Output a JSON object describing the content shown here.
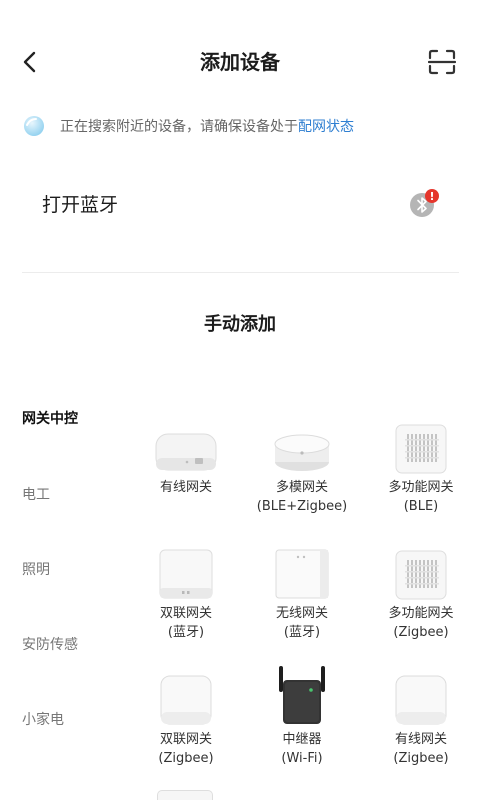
{
  "header": {
    "title": "添加设备",
    "back_icon": "chevron-left-icon",
    "scan_icon": "scan-frame-icon"
  },
  "notice": {
    "text": "正在搜索附近的设备，请确保设备处于",
    "link": "配网状态",
    "link_color": "#2f7fd1"
  },
  "bluetooth": {
    "label": "打开蓝牙",
    "alert_mark": "!",
    "badge_color": "#e5362c"
  },
  "manual": {
    "title": "手动添加"
  },
  "sidebar": {
    "items": [
      {
        "label": "网关中控",
        "active": true
      },
      {
        "label": "电工",
        "active": false
      },
      {
        "label": "照明",
        "active": false
      },
      {
        "label": "安防传感",
        "active": false
      },
      {
        "label": "小家电",
        "active": false
      }
    ]
  },
  "devices": [
    {
      "name1": "有线网关",
      "name2": "",
      "icon": "wired-gateway-icon"
    },
    {
      "name1": "多模网关",
      "name2": "(BLE+Zigbee)",
      "icon": "multimode-gateway-icon"
    },
    {
      "name1": "多功能网关",
      "name2": "(BLE)",
      "icon": "multifunction-gateway-icon"
    },
    {
      "name1": "双联网关",
      "name2": "(蓝牙)",
      "icon": "dual-gateway-icon"
    },
    {
      "name1": "无线网关",
      "name2": "(蓝牙)",
      "icon": "wireless-gateway-icon"
    },
    {
      "name1": "多功能网关",
      "name2": "(Zigbee)",
      "icon": "multifunction-gateway-icon"
    },
    {
      "name1": "双联网关",
      "name2": "(Zigbee)",
      "icon": "dual-gateway-icon"
    },
    {
      "name1": "中继器",
      "name2": "(Wi-Fi)",
      "icon": "wifi-repeater-icon"
    },
    {
      "name1": "有线网关",
      "name2": "(Zigbee)",
      "icon": "wired-gateway-icon"
    }
  ]
}
